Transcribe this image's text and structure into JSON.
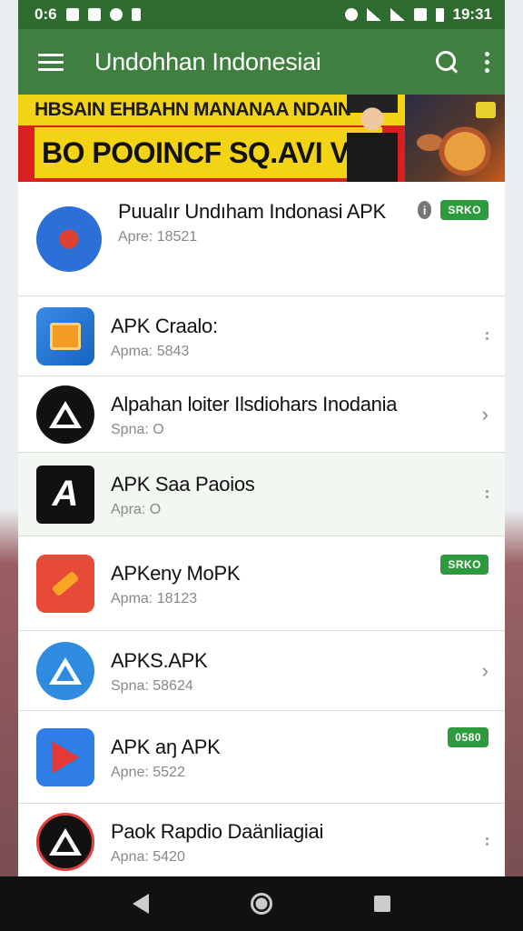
{
  "status_bar": {
    "time_left": "0:6",
    "time_right": "19:31"
  },
  "app_bar": {
    "title": "Undohhan Indonesiai"
  },
  "banner": {
    "line1": "HBSAIN EHBAHN MANANAA NDAIN",
    "line2": "BO POOINCF SQ.AVI VAI"
  },
  "apps": [
    {
      "title": "Puualır Undıham Indonasi APK",
      "subtitle": "Apre: 18521",
      "icon": "compass-icon",
      "action": "chip",
      "chip_label": "SRKO",
      "info": "i"
    },
    {
      "title": "APK Craalo:",
      "subtitle": "Apma: 5843",
      "icon": "folder-icon",
      "action": "dots"
    },
    {
      "title": "Alpahan loiter Ilsdiohars Inodania",
      "subtitle": "Spna: O",
      "icon": "triangle-logo-icon",
      "action": "chevron",
      "chevron": "›"
    },
    {
      "title": "APK Saa Paoios",
      "subtitle": "Apra: O",
      "icon": "letter-a-icon",
      "letter": "A",
      "action": "dots"
    },
    {
      "title": "APKeny MoPK",
      "subtitle": "Apma: 18123",
      "icon": "tool-icon",
      "action": "chip",
      "chip_label": "SRKO"
    },
    {
      "title": "APKS.APK",
      "subtitle": "Spna: 58624",
      "icon": "triangle-logo-icon",
      "action": "chevron",
      "chevron": "›"
    },
    {
      "title": "APK aŋ APK",
      "subtitle": "Apne: 5522",
      "icon": "play-icon",
      "action": "chip",
      "chip_label": "0580"
    },
    {
      "title": "Paok Rapdio Daänliagiai",
      "subtitle": "Apna: 5420",
      "icon": "emblem-icon",
      "action": "dots"
    }
  ],
  "colors": {
    "status_bar": "#2e6b2e",
    "app_bar": "#3f7f3f",
    "chip": "#2e9a3e"
  }
}
